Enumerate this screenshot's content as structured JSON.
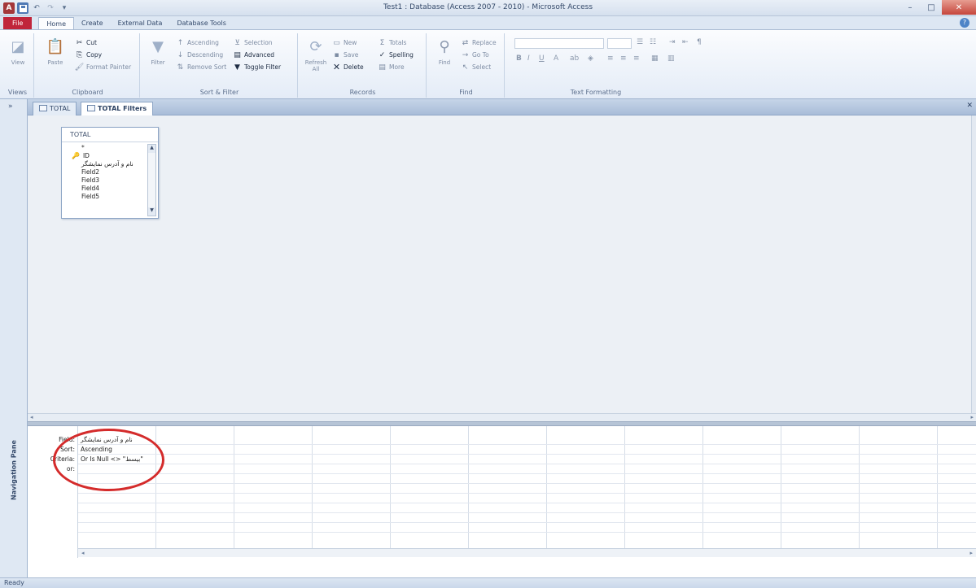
{
  "window": {
    "title": "Test1 : Database (Access 2007 - 2010) - Microsoft Access",
    "qat": {
      "app_icon": "A",
      "save_icon": "floppy-icon",
      "undo": "↶",
      "redo": "↷",
      "more": "▾"
    },
    "controls": {
      "minimize": "–",
      "maximize": "□",
      "close": "✕"
    }
  },
  "ribbon": {
    "tabs": [
      "File",
      "Home",
      "Create",
      "External Data",
      "Database Tools"
    ],
    "active_tab": "Home",
    "help": "?",
    "groups": {
      "views": {
        "label": "Views",
        "view": "View"
      },
      "clipboard": {
        "label": "Clipboard",
        "paste": "Paste",
        "cut": "Cut",
        "copy": "Copy",
        "format_painter": "Format Painter"
      },
      "sort_filter": {
        "label": "Sort & Filter",
        "filter": "Filter",
        "ascending": "Ascending",
        "descending": "Descending",
        "remove_sort": "Remove Sort",
        "selection": "Selection",
        "advanced": "Advanced",
        "toggle_filter": "Toggle Filter"
      },
      "records": {
        "label": "Records",
        "refresh": "Refresh All",
        "new": "New",
        "save": "Save",
        "delete": "Delete",
        "totals": "Totals",
        "spelling": "Spelling",
        "more": "More"
      },
      "find": {
        "label": "Find",
        "find": "Find",
        "replace": "Replace",
        "goto": "Go To",
        "select": "Select"
      },
      "text_formatting": {
        "label": "Text Formatting",
        "bold": "B",
        "italic": "I",
        "underline": "U"
      }
    }
  },
  "navigation_pane": {
    "label": "Navigation Pane",
    "toggle": "»"
  },
  "document_tabs": [
    {
      "label": "TOTAL",
      "active": false
    },
    {
      "label": "TOTAL Filters",
      "active": true
    }
  ],
  "table_box": {
    "title": "TOTAL",
    "fields": [
      "*",
      "ID",
      "نام و آدرس نمایشگر",
      "Field2",
      "Field3",
      "Field4",
      "Field5"
    ]
  },
  "query_grid": {
    "row_labels": [
      "Field:",
      "Sort:",
      "Criteria:",
      "or:"
    ],
    "column1": {
      "field": "نام و آدرس نمایشگر",
      "sort": "Ascending",
      "criteria": "\"بیسط\" <> Or Is Null"
    }
  },
  "status_bar": {
    "text": "Ready"
  }
}
